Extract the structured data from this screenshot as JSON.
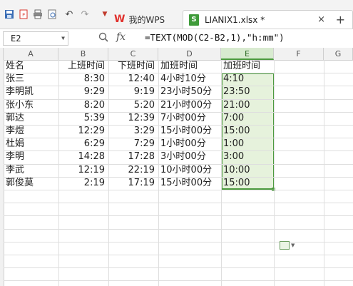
{
  "tabs": {
    "wps_label": "我的WPS",
    "file_label": "LIANIX1.xlsx *",
    "close_glyph": "×",
    "new_glyph": "+"
  },
  "formula_bar": {
    "cell_ref": "E2",
    "fx_label": "fx",
    "formula": "=TEXT(MOD(C2-B2,1),\"h:mm\")"
  },
  "columns": [
    "A",
    "B",
    "C",
    "D",
    "E",
    "F",
    "G"
  ],
  "selected_column": "E",
  "headers": [
    "姓名",
    "上班时间",
    "下班时间",
    "加班时间",
    "加班时间"
  ],
  "rows": [
    [
      "张三",
      "8:30",
      "12:40",
      "4小时10分",
      "4:10"
    ],
    [
      "李明凯",
      "9:29",
      "9:19",
      "23小时50分",
      "23:50"
    ],
    [
      "张小东",
      "8:20",
      "5:20",
      "21小时00分",
      "21:00"
    ],
    [
      "郭达",
      "5:39",
      "12:39",
      "7小时00分",
      "7:00"
    ],
    [
      "李煜",
      "12:29",
      "3:29",
      "15小时00分",
      "15:00"
    ],
    [
      "杜娟",
      "6:29",
      "7:29",
      "1小时00分",
      "1:00"
    ],
    [
      "李明",
      "14:28",
      "17:28",
      "3小时00分",
      "3:00"
    ],
    [
      "李武",
      "12:19",
      "22:19",
      "10小时00分",
      "10:00"
    ],
    [
      "郭俊莫",
      "2:19",
      "17:19",
      "15小时00分",
      "15:00"
    ]
  ],
  "colors": {
    "selection_border": "#4c9a3e",
    "selection_fill": "#e6f2dc",
    "wps_red": "#e0322e",
    "xlsx_green": "#3f9b3a"
  }
}
